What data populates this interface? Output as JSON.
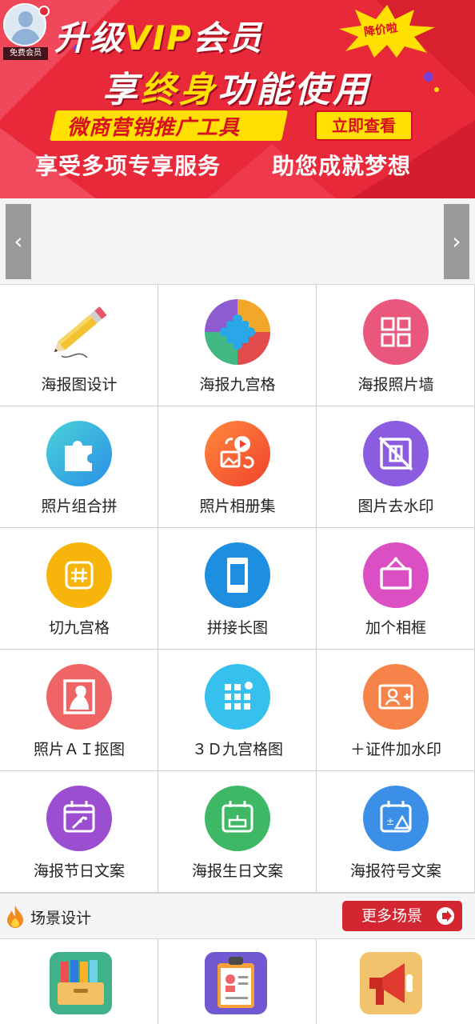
{
  "banner": {
    "member_tag": "免费会员",
    "title_prefix": "升级",
    "title_vip": "VIP",
    "title_suffix": "会员",
    "sub_a": "享",
    "sub_hl": "终身",
    "sub_b": "功能使用",
    "burst_label": "降价啦",
    "tool_tag": "微商营销推广工具",
    "view_button": "立即查看",
    "bottom_left": "享受多项专享服务",
    "bottom_right": "助您成就梦想"
  },
  "carousel": {
    "prev": "‹",
    "next": "›"
  },
  "tools": [
    {
      "label": "海报图设计",
      "icon": "pencil-icon"
    },
    {
      "label": "海报九宫格",
      "icon": "puzzle-circle-icon"
    },
    {
      "label": "海报照片墙",
      "icon": "grid-icon"
    },
    {
      "label": "照片组合拼",
      "icon": "puzzle-piece-icon"
    },
    {
      "label": "照片相册集",
      "icon": "album-icon"
    },
    {
      "label": "图片去水印",
      "icon": "remove-watermark-icon"
    },
    {
      "label": "切九宫格",
      "icon": "hash-icon"
    },
    {
      "label": "拼接长图",
      "icon": "long-image-icon"
    },
    {
      "label": "加个相框",
      "icon": "frame-icon"
    },
    {
      "label": "照片ＡＩ抠图",
      "icon": "portrait-cutout-icon"
    },
    {
      "label": "３Ｄ九宫格图",
      "icon": "3d-grid-icon"
    },
    {
      "label": "＋证件加水印",
      "icon": "id-card-icon"
    },
    {
      "label": "海报节日文案",
      "icon": "holiday-calendar-icon"
    },
    {
      "label": "海报生日文案",
      "icon": "birthday-calendar-icon"
    },
    {
      "label": "海报符号文案",
      "icon": "symbol-calendar-icon"
    }
  ],
  "scene": {
    "title": "场景设计",
    "more_button": "更多场景"
  },
  "scene_items": [
    {
      "icon": "folder-box-icon"
    },
    {
      "icon": "badge-icon"
    },
    {
      "icon": "megaphone-icon"
    }
  ],
  "colors": {
    "banner_red": "#e8293a",
    "accent_yellow": "#ffe000",
    "button_red": "#d32630"
  }
}
